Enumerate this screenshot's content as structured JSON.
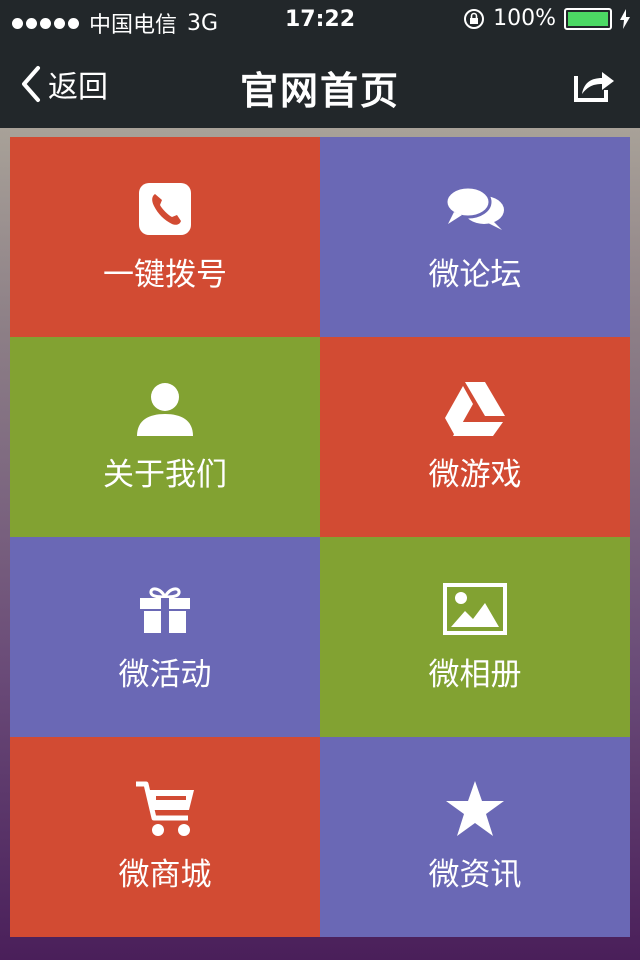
{
  "status": {
    "carrier": "中国电信",
    "network": "3G",
    "time": "17:22",
    "battery": "100%"
  },
  "nav": {
    "back_label": "返回",
    "title": "官网首页"
  },
  "colors": {
    "red": "#d24b33",
    "purple": "#6a68b5",
    "green": "#82a232",
    "bar": "#22272a"
  },
  "tiles": [
    {
      "label": "一键拨号",
      "icon": "phone-icon"
    },
    {
      "label": "微论坛",
      "icon": "chat-bubbles-icon"
    },
    {
      "label": "关于我们",
      "icon": "user-icon"
    },
    {
      "label": "微游戏",
      "icon": "drive-triangle-icon"
    },
    {
      "label": "微活动",
      "icon": "gift-icon"
    },
    {
      "label": "微相册",
      "icon": "picture-icon"
    },
    {
      "label": "微商城",
      "icon": "shopping-cart-icon"
    },
    {
      "label": "微资讯",
      "icon": "star-icon"
    }
  ]
}
